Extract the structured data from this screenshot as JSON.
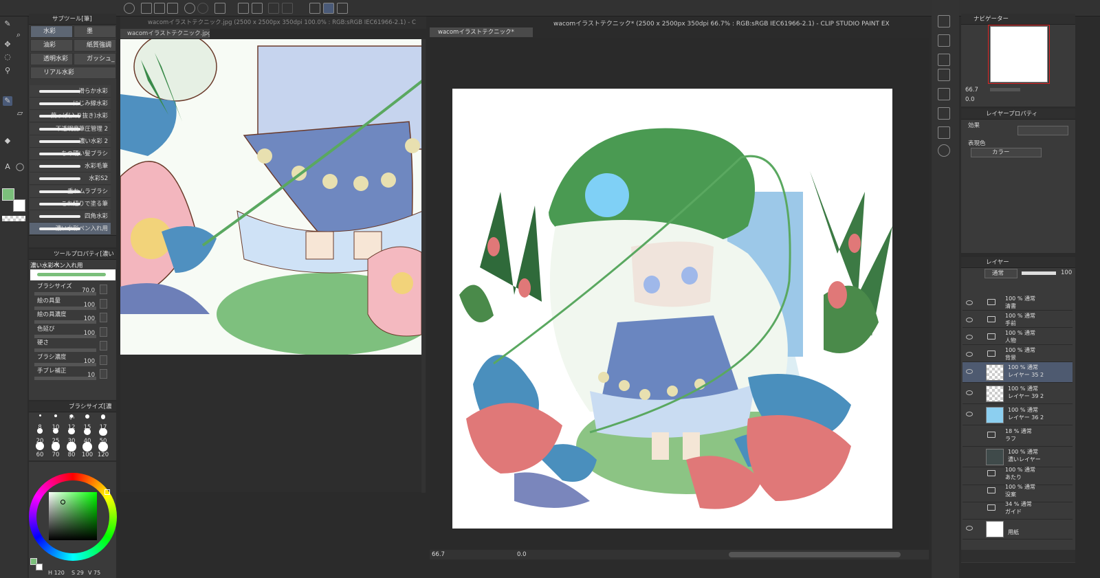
{
  "window": {
    "title": "wacomイラストテクニック* (2500 x 2500px 350dpi 66.7% : RGB:sRGB IEC61966-2.1) - CLIP STUDIO PAINT EX"
  },
  "left_doc": {
    "title": "wacomイラストテクニック.jpg (2500 x 2500px 350dpi 100.0% : RGB:sRGB IEC61966-2.1) - C",
    "tab": "wacomイラストテクニック.jpg"
  },
  "main_doc": {
    "tab": "wacomイラストテクニック*",
    "zoom": "66.7",
    "rotation": "0.0"
  },
  "subtool": {
    "header": "サブツール[筆]",
    "groups": [
      "水彩",
      "墨",
      "油彩",
      "紙質強調",
      "透明水彩 2",
      "ガッシュ_",
      "リアル水彩"
    ],
    "brushes": [
      "滑らか水彩",
      "にじみ縁水彩",
      "葉っぱ(入り抜き)水彩",
      "不透明度筆圧管理 2",
      "濃い水彩 2",
      "ちの硬い髪ブラシ",
      "水彩毛筆",
      "水彩S2",
      "重ねムラブラシ",
      "これ紐りで塗る筆",
      "四角水彩",
      "濃い水彩ペン入れ用"
    ]
  },
  "tool_property": {
    "header": "ツールプロパティ[濃い水",
    "name": "濃い水彩ペン入れ用",
    "rows": [
      {
        "label": "ブラシサイズ",
        "value": "70.0"
      },
      {
        "label": "絵の具量",
        "value": "100"
      },
      {
        "label": "絵の具濃度",
        "value": "100"
      },
      {
        "label": "色延び",
        "value": "100"
      },
      {
        "label": "硬さ",
        "value": ""
      },
      {
        "label": "ブラシ濃度",
        "value": "100"
      },
      {
        "label": "手ブレ補正",
        "value": "10"
      }
    ]
  },
  "brush_size": {
    "header": "ブラシサイズ[濃い",
    "sizes": [
      "8",
      "10",
      "12",
      "15",
      "17",
      "20",
      "25",
      "30",
      "40",
      "50",
      "60",
      "70",
      "80",
      "100",
      "120"
    ]
  },
  "color": {
    "main": "#7bbf7b",
    "sub": "#ffffff",
    "h": "120",
    "s": "29",
    "v": "75"
  },
  "navigator": {
    "header": "ナビゲーター",
    "zoom": "66.7",
    "angle": "0.0"
  },
  "layer_property": {
    "header": "レイヤープロパティ",
    "effect_label": "効果",
    "expression_label": "表現色",
    "expression_value": "カラー"
  },
  "layers_panel": {
    "header": "レイヤー",
    "blend": "通常",
    "opacity": "100",
    "items": [
      {
        "meta": "100 % 通常",
        "name": "清書"
      },
      {
        "meta": "100 % 通常",
        "name": "手前"
      },
      {
        "meta": "100 % 通常",
        "name": "人物"
      },
      {
        "meta": "100 % 通常",
        "name": "背景"
      },
      {
        "meta": "100 % 通常",
        "name": "レイヤー 35 2"
      },
      {
        "meta": "100 % 通常",
        "name": "レイヤー 39 2"
      },
      {
        "meta": "100 % 通常",
        "name": "レイヤー 36 2"
      },
      {
        "meta": "18 % 通常",
        "name": "ラフ"
      },
      {
        "meta": "100 % 通常",
        "name": "濃いレイヤー"
      },
      {
        "meta": "100 % 通常",
        "name": "あたり"
      },
      {
        "meta": "100 % 通常",
        "name": "没案"
      },
      {
        "meta": "34 % 通常",
        "name": "ガイド"
      },
      {
        "meta": "",
        "name": "用紙"
      }
    ]
  },
  "colors": {
    "accent": "#5f7ea8",
    "green": "#4f9a55",
    "pink": "#e07878",
    "butterfly": "#4a8fbd"
  }
}
